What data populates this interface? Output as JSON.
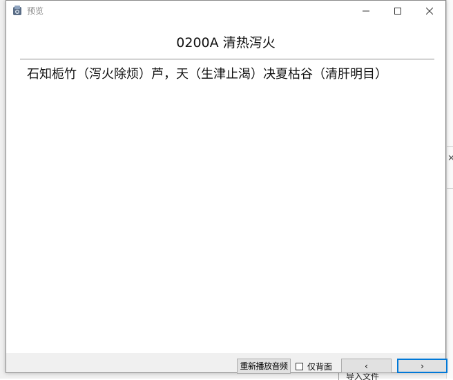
{
  "window": {
    "title": "预览",
    "controls": {
      "minimize": "minimize-icon",
      "maximize": "maximize-icon",
      "close": "close-icon"
    }
  },
  "main": {
    "heading": "0200A 清热泻火",
    "content": "石知栀竹（泻火除烦）芦，天（生津止渴）决夏枯谷（清肝明目）"
  },
  "footer": {
    "replay_label": "重新播放音频",
    "checkbox_label": "仅背面",
    "checkbox_checked": false,
    "prev_label": "‹",
    "next_label": "›"
  },
  "background": {
    "import_label": "导入文件"
  },
  "colors": {
    "accent": "#0078d7",
    "title_text": "#8a8a8a",
    "bar_bg": "#f0f0f0",
    "button_bg": "#e1e1e1"
  }
}
